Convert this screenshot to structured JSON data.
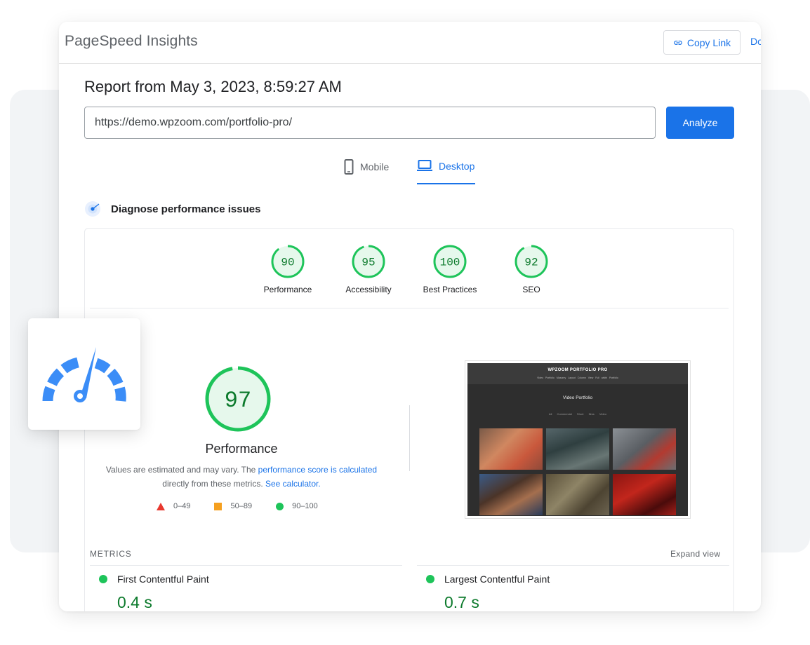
{
  "app": {
    "brand": "PageSpeed Insights",
    "copy_link_label": "Copy Link",
    "docs_label": "Do"
  },
  "report": {
    "title": "Report from May 3, 2023, 8:59:27 AM",
    "url_value": "https://demo.wpzoom.com/portfolio-pro/",
    "analyze_label": "Analyze"
  },
  "tabs": [
    {
      "label": "Mobile",
      "icon": "phone-icon",
      "active": false
    },
    {
      "label": "Desktop",
      "icon": "laptop-icon",
      "active": true
    }
  ],
  "diagnose": {
    "title": "Diagnose performance issues",
    "icon": "target-icon"
  },
  "categories": [
    {
      "score": "90",
      "score_value": 90,
      "label": "Performance"
    },
    {
      "score": "95",
      "score_value": 95,
      "label": "Accessibility"
    },
    {
      "score": "100",
      "score_value": 100,
      "label": "Best Practices"
    },
    {
      "score": "92",
      "score_value": 92,
      "label": "SEO"
    }
  ],
  "performance": {
    "score": "97",
    "score_value": 97,
    "title": "Performance",
    "desc_text_1": "Values are estimated and may vary. The ",
    "desc_link_1": "performance score is calculated",
    "desc_text_2": "directly from these metrics. ",
    "desc_link_2": "See calculator."
  },
  "legend": [
    {
      "range": "0–49",
      "shape": "triangle",
      "color": "#e8382f"
    },
    {
      "range": "50–89",
      "shape": "square",
      "color": "#f5a020"
    },
    {
      "range": "90–100",
      "shape": "circle",
      "color": "#1ec45a"
    }
  ],
  "screenshot": {
    "brand": "WPZOOM PORTFOLIO PRO",
    "nav": "Video Portfolio   Masonry Layout   Column View   Full width Portfolio",
    "title": "Video Portfolio",
    "filters": "All   Commercial   Short films   Video"
  },
  "metrics": {
    "label": "METRICS",
    "expand_label": "Expand view",
    "items": [
      {
        "name": "First Contentful Paint",
        "value": "0.4 s"
      },
      {
        "name": "Largest Contentful Paint",
        "value": "0.7 s"
      }
    ]
  },
  "float_card": {
    "icon": "speedometer-icon"
  },
  "colors": {
    "accent": "#1a73e8",
    "pass_green": "#0cce6b",
    "pass_text": "#0c7a2c"
  }
}
